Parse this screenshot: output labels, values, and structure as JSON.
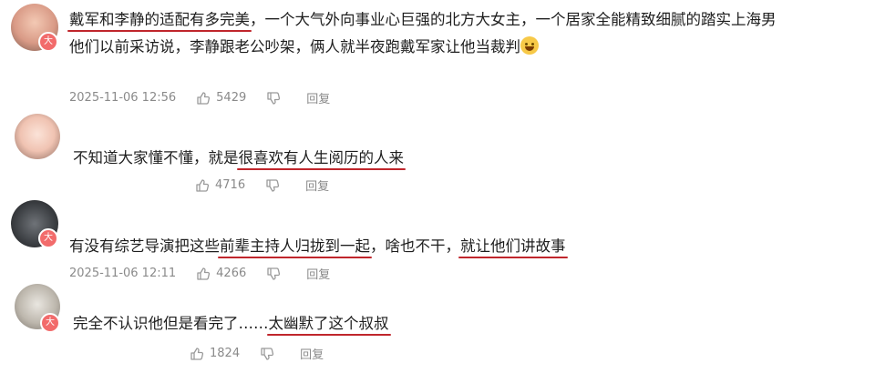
{
  "comments": [
    {
      "line1_pre": "",
      "line1_ul": "戴军和李静的适配有多完美",
      "line1_post": "，一个大气外向事业心巨强的北方大女主，一个居家全能精致细腻的踏实上海男",
      "line2": "他们以前采访说，李静跟老公吵架，俩人就半夜跑戴军家让他当裁判",
      "timestamp": "2025-11-06 12:56",
      "likes": "5429",
      "reply_label": "回复",
      "badge": "大"
    },
    {
      "pre": "不知道大家懂不懂，就是",
      "ul": "很喜欢有人生阅历的人来",
      "likes": "4716",
      "reply_label": "回复"
    },
    {
      "pre": "有没有综艺导演把这些",
      "ul1": "前辈主持人归拢到一起",
      "mid": "，啥也不干，",
      "ul2": "就让他们讲故事",
      "timestamp": "2025-11-06 12:11",
      "likes": "4266",
      "reply_label": "回复",
      "badge": "大"
    },
    {
      "pre": "完全不认识他但是看完了……",
      "ul": "太幽默了这个叔叔",
      "likes": "1824",
      "reply_label": "回复",
      "badge": "大"
    }
  ],
  "colors": {
    "underline": "#c0262c",
    "badge": "#f26b6b",
    "meta": "#8a8a8a"
  },
  "icons": {
    "like": "thumbs-up-icon",
    "dislike": "thumbs-down-icon",
    "emoji": "laughing-tears-emoji-icon"
  }
}
